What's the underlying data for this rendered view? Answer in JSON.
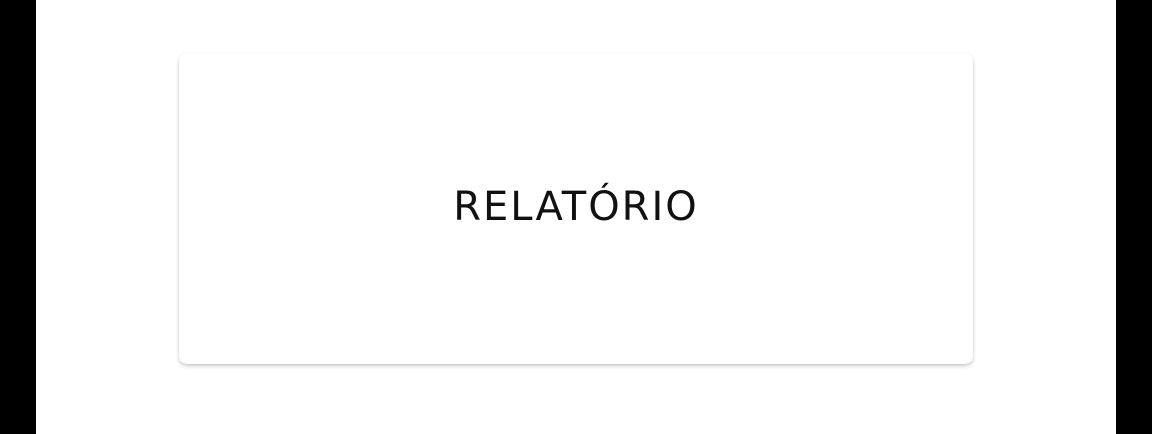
{
  "card": {
    "title": "RELATÓRIO"
  }
}
